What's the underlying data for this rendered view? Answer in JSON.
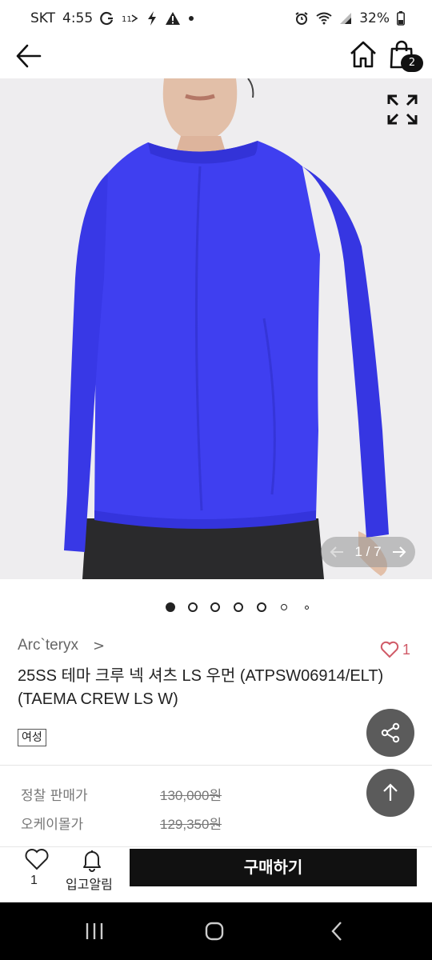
{
  "status_bar": {
    "carrier": "SKT",
    "time": "4:55",
    "battery": "32%"
  },
  "header": {
    "cart_count": "2"
  },
  "gallery": {
    "current": "1",
    "separator": "/",
    "total": "7",
    "pager_text": "1 / 7",
    "dot_count": 7,
    "active_dot": 0
  },
  "product": {
    "brand": "Arc`teryx",
    "brand_chevron": ">",
    "likes": "1",
    "title_line1": "25SS  테마 크루 넥 셔츠 LS 우먼 (ATPSW06914/ELT)",
    "title_line2": "(TAEMA CREW LS W)",
    "gender_tag": "여성"
  },
  "prices": [
    {
      "label": "정찰 판매가",
      "value": "130,000원"
    },
    {
      "label": "오케이몰가",
      "value": "129,350원"
    }
  ],
  "bottom_bar": {
    "wish_count": "1",
    "restock_alert_label": "입고알림",
    "buy_label": "구매하기"
  },
  "colors": {
    "shirt": "#3f3ff0",
    "heart": "#d05a67",
    "fab": "#5b5b5b"
  }
}
